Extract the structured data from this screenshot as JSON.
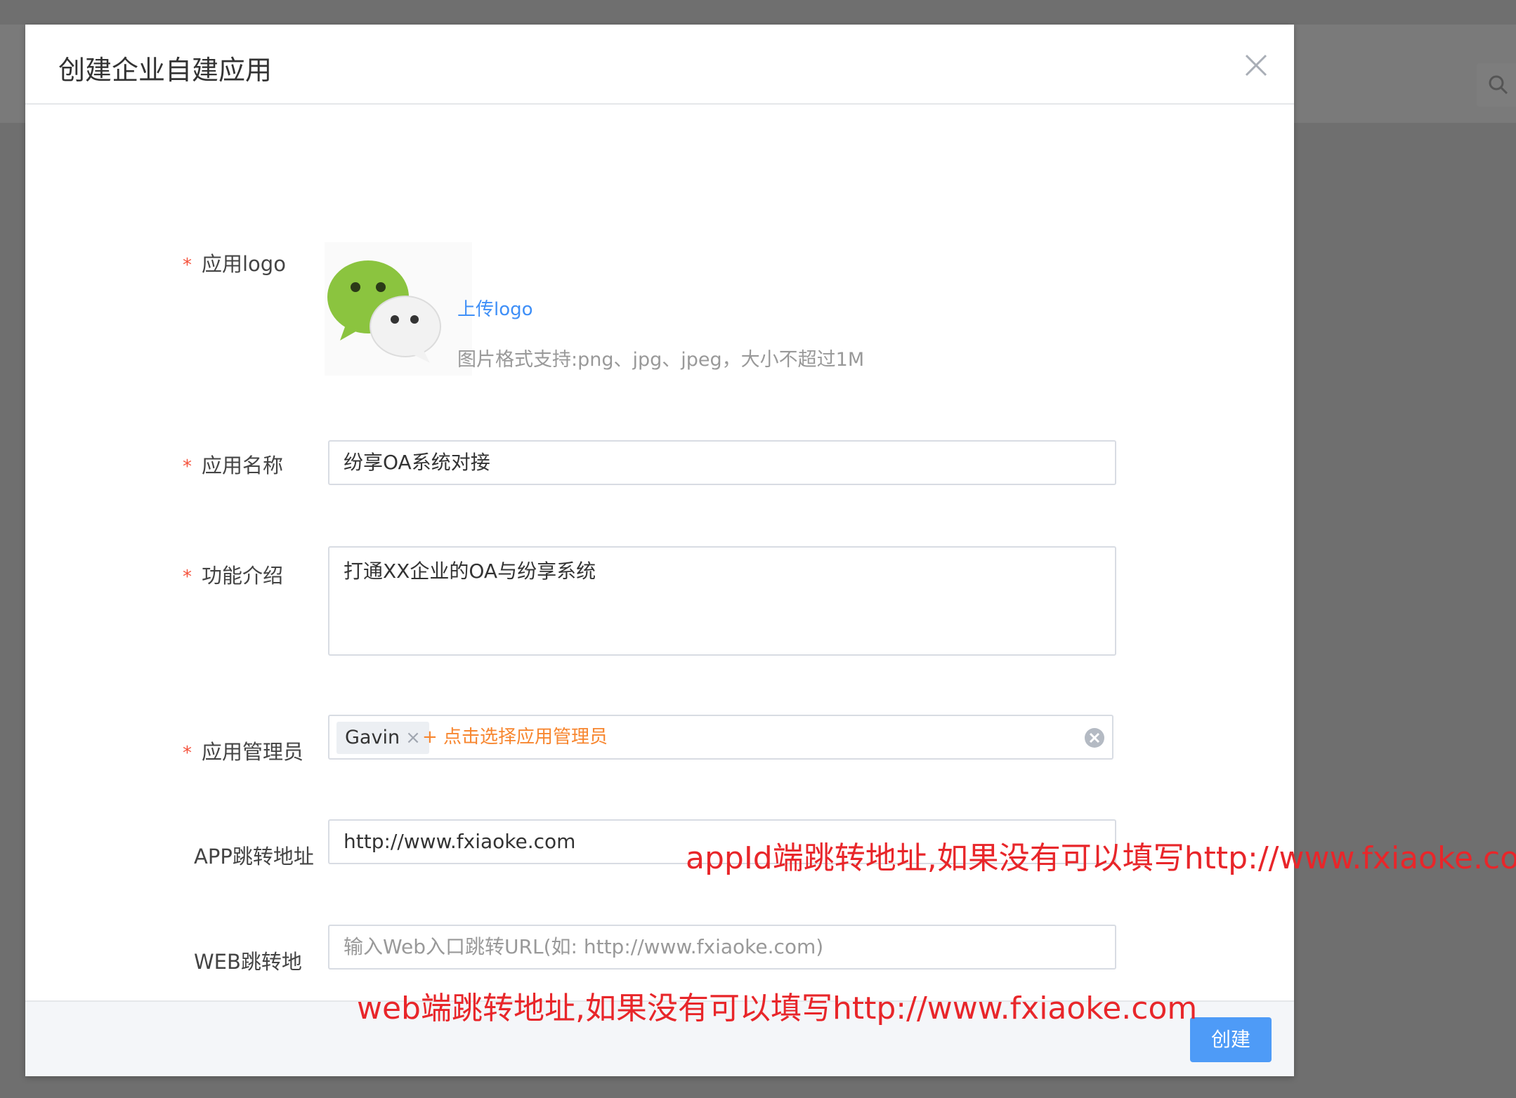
{
  "dialog": {
    "title": "创建企业自建应用",
    "close_icon": "close-icon"
  },
  "form": {
    "logo": {
      "label": "应用logo",
      "required_mark": "*",
      "upload_link": "上传logo",
      "hint": "图片格式支持:png、jpg、jpeg，大小不超过1M",
      "image_icon": "wechat-logo"
    },
    "app_name": {
      "label": "应用名称",
      "required_mark": "*",
      "value": "纷享OA系统对接"
    },
    "description": {
      "label": "功能介绍",
      "required_mark": "*",
      "value": "打通XX企业的OA与纷享系统"
    },
    "admins": {
      "label": "应用管理员",
      "required_mark": "*",
      "tags": [
        "Gavin"
      ],
      "add_label": "+ 点击选择应用管理员"
    },
    "app_url": {
      "label": "APP跳转地址",
      "value": "http://www.fxiaoke.com"
    },
    "web_url": {
      "label": "WEB跳转地",
      "placeholder": "输入Web入口跳转URL(如: http://www.fxiaoke.com)"
    }
  },
  "footer": {
    "create_label": "创建"
  },
  "annotations": {
    "app": "appId端跳转地址,如果没有可以填写http://www.fxiaoke.com",
    "web": "web端跳转地址,如果没有可以填写http://www.fxiaoke.com"
  },
  "colors": {
    "primary": "#4e9bf7",
    "link": "#3f8ff7",
    "required": "#f5533d",
    "accent_orange": "#f7862f",
    "annotation_red": "#e8262a",
    "overlay": "#6f6f6f"
  }
}
